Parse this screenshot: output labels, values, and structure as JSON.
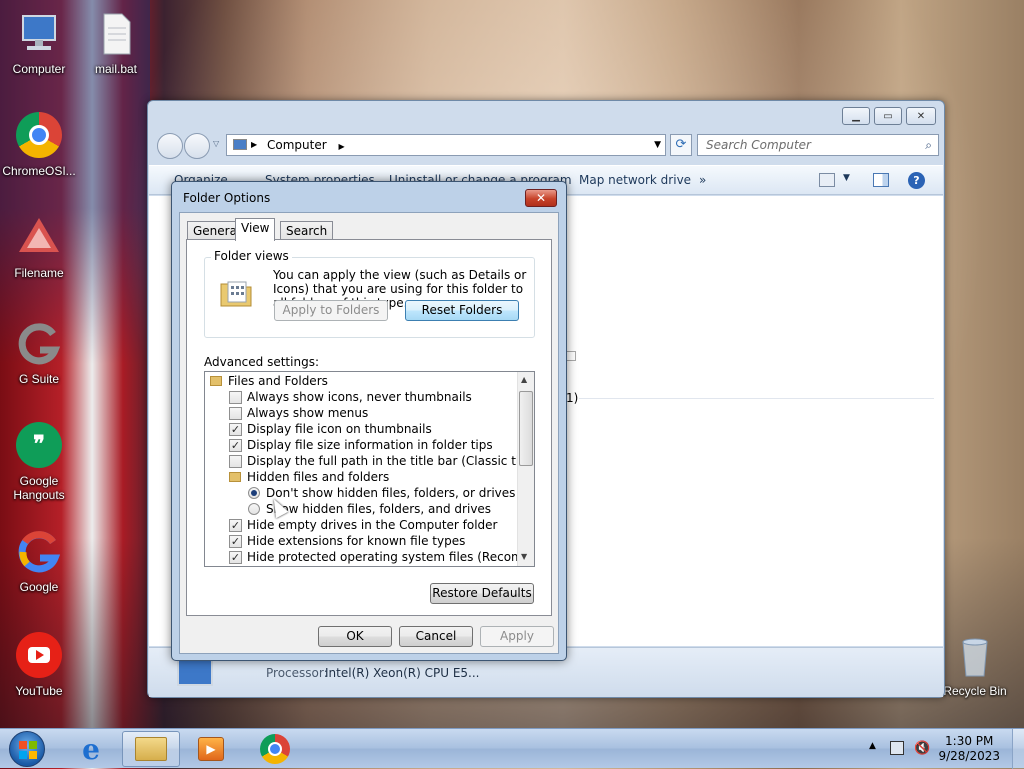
{
  "desktop": {
    "icons": [
      {
        "label": "Computer",
        "icon": "computer-icon"
      },
      {
        "label": "mail.bat",
        "icon": "batch-file-icon"
      },
      {
        "label": "ChromeOSI...",
        "icon": "chrome-icon"
      },
      {
        "label": "Filename",
        "icon": "drive-icon"
      },
      {
        "label": "G Suite",
        "icon": "gsuite-icon"
      },
      {
        "label": "Google Hangouts",
        "icon": "hangouts-icon"
      },
      {
        "label": "Google",
        "icon": "google-icon"
      },
      {
        "label": "YouTube",
        "icon": "youtube-icon"
      },
      {
        "label": "Recycle Bin",
        "icon": "recycle-bin-icon"
      }
    ]
  },
  "explorer": {
    "address": "Computer",
    "search_placeholder": "Search Computer",
    "toolbar": {
      "organize": "Organize",
      "system_properties": "System properties",
      "uninstall": "Uninstall or change a program",
      "map_network": "Map network drive",
      "more": "»"
    },
    "content_fragment": "1)",
    "details": {
      "processor_label": "Processor:",
      "processor_value": "Intel(R) Xeon(R) CPU E5..."
    }
  },
  "dialog": {
    "title": "Folder Options",
    "close_glyph": "✕",
    "tabs": [
      "General",
      "View",
      "Search"
    ],
    "active_tab": "View",
    "folder_views": {
      "label": "Folder views",
      "description": "You can apply the view (such as Details or Icons) that you are using for this folder to all folders of this type.",
      "apply_button": "Apply to Folders",
      "reset_button": "Reset Folders"
    },
    "advanced_label": "Advanced settings:",
    "settings": [
      {
        "type": "folder",
        "label": "Files and Folders"
      },
      {
        "type": "checkbox",
        "checked": false,
        "label": "Always show icons, never thumbnails"
      },
      {
        "type": "checkbox",
        "checked": false,
        "label": "Always show menus"
      },
      {
        "type": "checkbox",
        "checked": true,
        "label": "Display file icon on thumbnails"
      },
      {
        "type": "checkbox",
        "checked": true,
        "label": "Display file size information in folder tips"
      },
      {
        "type": "checkbox",
        "checked": false,
        "label": "Display the full path in the title bar (Classic theme only)"
      },
      {
        "type": "folder",
        "label": "Hidden files and folders"
      },
      {
        "type": "radio",
        "checked": true,
        "label": "Don't show hidden files, folders, or drives"
      },
      {
        "type": "radio",
        "checked": false,
        "label": "Show hidden files, folders, and drives"
      },
      {
        "type": "checkbox",
        "checked": true,
        "label": "Hide empty drives in the Computer folder"
      },
      {
        "type": "checkbox",
        "checked": true,
        "label": "Hide extensions for known file types"
      },
      {
        "type": "checkbox",
        "checked": true,
        "label": "Hide protected operating system files (Recommended)"
      }
    ],
    "restore_button": "Restore Defaults",
    "ok": "OK",
    "cancel": "Cancel",
    "apply": "Apply",
    "check_glyph": "✓"
  },
  "taskbar": {
    "items": [
      "start-orb",
      "internet-explorer",
      "windows-explorer",
      "media-player",
      "chrome"
    ],
    "active_item": "windows-explorer",
    "time": "1:30 PM",
    "date": "9/28/2023"
  }
}
